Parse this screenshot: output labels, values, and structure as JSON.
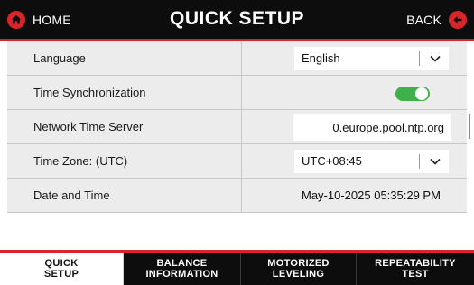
{
  "header": {
    "home_label": "HOME",
    "title": "QUICK SETUP",
    "back_label": "BACK",
    "home_icon": "home-icon",
    "back_icon": "back-arrow-icon",
    "accent_color": "#d9252a"
  },
  "settings": {
    "language": {
      "label": "Language",
      "value": "English"
    },
    "time_sync": {
      "label": "Time Synchronization",
      "enabled": true,
      "on_color": "#3fb149"
    },
    "ntp_server": {
      "label": "Network Time Server",
      "value": "0.europe.pool.ntp.org"
    },
    "time_zone": {
      "label": "Time Zone: (UTC)",
      "value": "UTC+08:45"
    },
    "date_time": {
      "label": "Date and Time",
      "value": "May-10-2025 05:35:29 PM"
    }
  },
  "tabs": [
    {
      "label": "QUICK\nSETUP",
      "active": true
    },
    {
      "label": "BALANCE\nINFORMATION",
      "active": false
    },
    {
      "label": "MOTORIZED\nLEVELING",
      "active": false
    },
    {
      "label": "REPEATABILITY\nTEST",
      "active": false
    }
  ]
}
